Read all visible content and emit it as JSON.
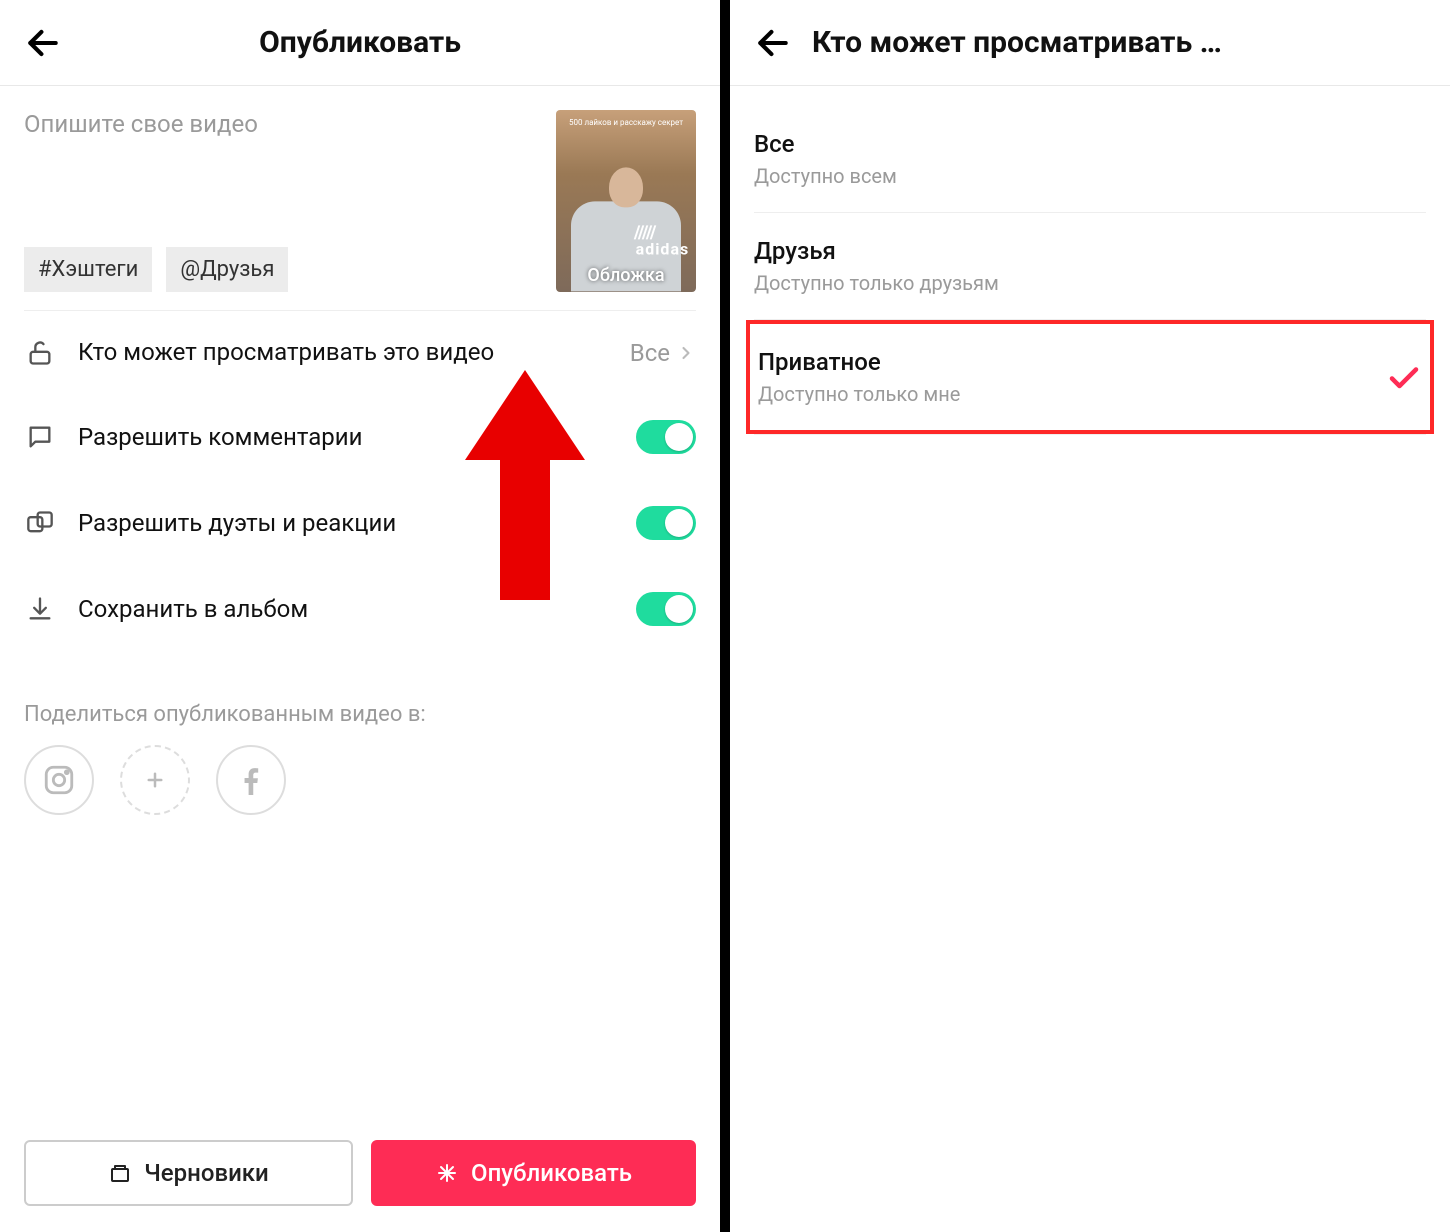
{
  "left": {
    "header_title": "Опубликовать",
    "caption_placeholder": "Опишите свое видео",
    "hashtag_pill": "#Хэштеги",
    "friends_pill": "@Друзья",
    "thumb": {
      "cover_label": "Обложка",
      "overlay_text": "500 лайков и расскажу секрет",
      "logo_text": "adidas"
    },
    "settings": {
      "privacy_label": "Кто может просматривать это видео",
      "privacy_value": "Все",
      "comments_label": "Разрешить комментарии",
      "duets_label": "Разрешить дуэты и реакции",
      "save_label": "Сохранить в альбом"
    },
    "share_label": "Поделиться опубликованным видео в:",
    "drafts_button": "Черновики",
    "publish_button": "Опубликовать"
  },
  "right": {
    "header_title": "Кто может просматривать …",
    "options": [
      {
        "title": "Все",
        "subtitle": "Доступно всем",
        "selected": false
      },
      {
        "title": "Друзья",
        "subtitle": "Доступно только друзьям",
        "selected": false
      },
      {
        "title": "Приватное",
        "subtitle": "Доступно только мне",
        "selected": true
      }
    ]
  }
}
